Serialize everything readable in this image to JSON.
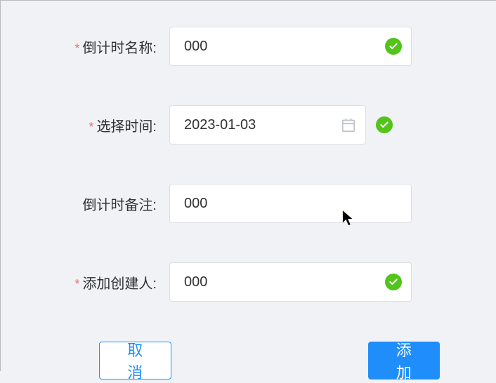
{
  "form": {
    "fields": {
      "countdown_name": {
        "label": "倒计时名称:",
        "required": true,
        "value": "000",
        "validated": true
      },
      "select_time": {
        "label": "选择时间:",
        "required": true,
        "value": "2023-01-03",
        "validated": true
      },
      "countdown_note": {
        "label": "倒计时备注:",
        "required": false,
        "value": "000",
        "validated": false
      },
      "add_creator": {
        "label": "添加创建人:",
        "required": true,
        "value": "000",
        "validated": true
      }
    }
  },
  "buttons": {
    "cancel": "取消",
    "add": "添加"
  },
  "required_mark": "*"
}
